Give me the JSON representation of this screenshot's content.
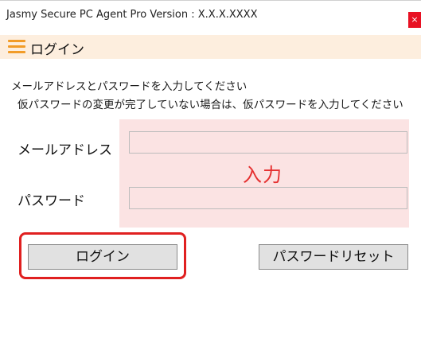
{
  "window": {
    "title": "Jasmy Secure PC Agent Pro Version : X.X.X.XXXX",
    "close_label": "×"
  },
  "header": {
    "menu_icon": "hamburger-menu-icon",
    "title": "ログイン",
    "accent_color": "#f29c28"
  },
  "instructions": {
    "line1": "メールアドレスとパスワードを入力してください",
    "line2": "仮パスワードの変更が完了していない場合は、仮パスワードを入力してください"
  },
  "form": {
    "email_label": "メールアドレス",
    "email_value": "",
    "password_label": "パスワード",
    "password_value": "",
    "input_hint": "入力"
  },
  "buttons": {
    "login_label": "ログイン",
    "reset_label": "パスワードリセット"
  },
  "colors": {
    "highlight": "#e02020",
    "input_zone": "#fbe3e3",
    "close": "#e81123"
  }
}
